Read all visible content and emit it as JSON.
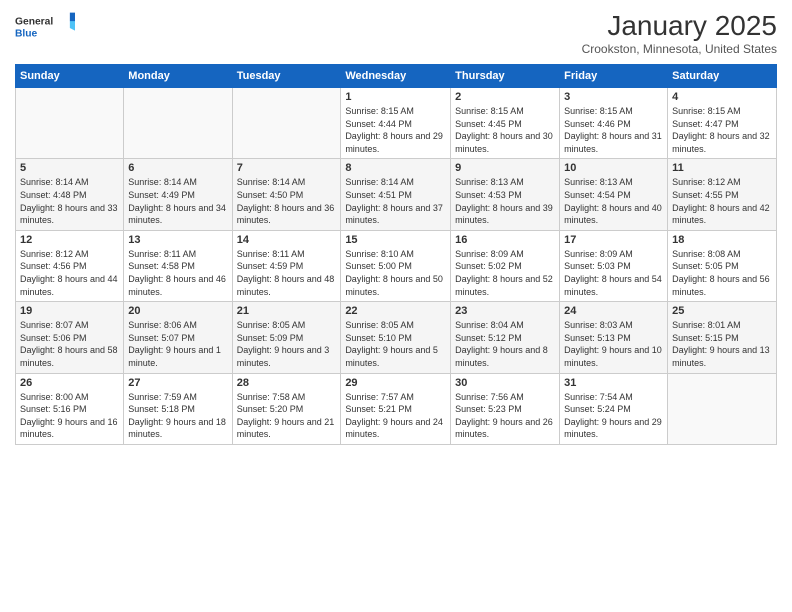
{
  "logo": {
    "general": "General",
    "blue": "Blue"
  },
  "header": {
    "title": "January 2025",
    "location": "Crookston, Minnesota, United States"
  },
  "weekdays": [
    "Sunday",
    "Monday",
    "Tuesday",
    "Wednesday",
    "Thursday",
    "Friday",
    "Saturday"
  ],
  "weeks": [
    [
      {
        "day": "",
        "sunrise": "",
        "sunset": "",
        "daylight": ""
      },
      {
        "day": "",
        "sunrise": "",
        "sunset": "",
        "daylight": ""
      },
      {
        "day": "",
        "sunrise": "",
        "sunset": "",
        "daylight": ""
      },
      {
        "day": "1",
        "sunrise": "Sunrise: 8:15 AM",
        "sunset": "Sunset: 4:44 PM",
        "daylight": "Daylight: 8 hours and 29 minutes."
      },
      {
        "day": "2",
        "sunrise": "Sunrise: 8:15 AM",
        "sunset": "Sunset: 4:45 PM",
        "daylight": "Daylight: 8 hours and 30 minutes."
      },
      {
        "day": "3",
        "sunrise": "Sunrise: 8:15 AM",
        "sunset": "Sunset: 4:46 PM",
        "daylight": "Daylight: 8 hours and 31 minutes."
      },
      {
        "day": "4",
        "sunrise": "Sunrise: 8:15 AM",
        "sunset": "Sunset: 4:47 PM",
        "daylight": "Daylight: 8 hours and 32 minutes."
      }
    ],
    [
      {
        "day": "5",
        "sunrise": "Sunrise: 8:14 AM",
        "sunset": "Sunset: 4:48 PM",
        "daylight": "Daylight: 8 hours and 33 minutes."
      },
      {
        "day": "6",
        "sunrise": "Sunrise: 8:14 AM",
        "sunset": "Sunset: 4:49 PM",
        "daylight": "Daylight: 8 hours and 34 minutes."
      },
      {
        "day": "7",
        "sunrise": "Sunrise: 8:14 AM",
        "sunset": "Sunset: 4:50 PM",
        "daylight": "Daylight: 8 hours and 36 minutes."
      },
      {
        "day": "8",
        "sunrise": "Sunrise: 8:14 AM",
        "sunset": "Sunset: 4:51 PM",
        "daylight": "Daylight: 8 hours and 37 minutes."
      },
      {
        "day": "9",
        "sunrise": "Sunrise: 8:13 AM",
        "sunset": "Sunset: 4:53 PM",
        "daylight": "Daylight: 8 hours and 39 minutes."
      },
      {
        "day": "10",
        "sunrise": "Sunrise: 8:13 AM",
        "sunset": "Sunset: 4:54 PM",
        "daylight": "Daylight: 8 hours and 40 minutes."
      },
      {
        "day": "11",
        "sunrise": "Sunrise: 8:12 AM",
        "sunset": "Sunset: 4:55 PM",
        "daylight": "Daylight: 8 hours and 42 minutes."
      }
    ],
    [
      {
        "day": "12",
        "sunrise": "Sunrise: 8:12 AM",
        "sunset": "Sunset: 4:56 PM",
        "daylight": "Daylight: 8 hours and 44 minutes."
      },
      {
        "day": "13",
        "sunrise": "Sunrise: 8:11 AM",
        "sunset": "Sunset: 4:58 PM",
        "daylight": "Daylight: 8 hours and 46 minutes."
      },
      {
        "day": "14",
        "sunrise": "Sunrise: 8:11 AM",
        "sunset": "Sunset: 4:59 PM",
        "daylight": "Daylight: 8 hours and 48 minutes."
      },
      {
        "day": "15",
        "sunrise": "Sunrise: 8:10 AM",
        "sunset": "Sunset: 5:00 PM",
        "daylight": "Daylight: 8 hours and 50 minutes."
      },
      {
        "day": "16",
        "sunrise": "Sunrise: 8:09 AM",
        "sunset": "Sunset: 5:02 PM",
        "daylight": "Daylight: 8 hours and 52 minutes."
      },
      {
        "day": "17",
        "sunrise": "Sunrise: 8:09 AM",
        "sunset": "Sunset: 5:03 PM",
        "daylight": "Daylight: 8 hours and 54 minutes."
      },
      {
        "day": "18",
        "sunrise": "Sunrise: 8:08 AM",
        "sunset": "Sunset: 5:05 PM",
        "daylight": "Daylight: 8 hours and 56 minutes."
      }
    ],
    [
      {
        "day": "19",
        "sunrise": "Sunrise: 8:07 AM",
        "sunset": "Sunset: 5:06 PM",
        "daylight": "Daylight: 8 hours and 58 minutes."
      },
      {
        "day": "20",
        "sunrise": "Sunrise: 8:06 AM",
        "sunset": "Sunset: 5:07 PM",
        "daylight": "Daylight: 9 hours and 1 minute."
      },
      {
        "day": "21",
        "sunrise": "Sunrise: 8:05 AM",
        "sunset": "Sunset: 5:09 PM",
        "daylight": "Daylight: 9 hours and 3 minutes."
      },
      {
        "day": "22",
        "sunrise": "Sunrise: 8:05 AM",
        "sunset": "Sunset: 5:10 PM",
        "daylight": "Daylight: 9 hours and 5 minutes."
      },
      {
        "day": "23",
        "sunrise": "Sunrise: 8:04 AM",
        "sunset": "Sunset: 5:12 PM",
        "daylight": "Daylight: 9 hours and 8 minutes."
      },
      {
        "day": "24",
        "sunrise": "Sunrise: 8:03 AM",
        "sunset": "Sunset: 5:13 PM",
        "daylight": "Daylight: 9 hours and 10 minutes."
      },
      {
        "day": "25",
        "sunrise": "Sunrise: 8:01 AM",
        "sunset": "Sunset: 5:15 PM",
        "daylight": "Daylight: 9 hours and 13 minutes."
      }
    ],
    [
      {
        "day": "26",
        "sunrise": "Sunrise: 8:00 AM",
        "sunset": "Sunset: 5:16 PM",
        "daylight": "Daylight: 9 hours and 16 minutes."
      },
      {
        "day": "27",
        "sunrise": "Sunrise: 7:59 AM",
        "sunset": "Sunset: 5:18 PM",
        "daylight": "Daylight: 9 hours and 18 minutes."
      },
      {
        "day": "28",
        "sunrise": "Sunrise: 7:58 AM",
        "sunset": "Sunset: 5:20 PM",
        "daylight": "Daylight: 9 hours and 21 minutes."
      },
      {
        "day": "29",
        "sunrise": "Sunrise: 7:57 AM",
        "sunset": "Sunset: 5:21 PM",
        "daylight": "Daylight: 9 hours and 24 minutes."
      },
      {
        "day": "30",
        "sunrise": "Sunrise: 7:56 AM",
        "sunset": "Sunset: 5:23 PM",
        "daylight": "Daylight: 9 hours and 26 minutes."
      },
      {
        "day": "31",
        "sunrise": "Sunrise: 7:54 AM",
        "sunset": "Sunset: 5:24 PM",
        "daylight": "Daylight: 9 hours and 29 minutes."
      },
      {
        "day": "",
        "sunrise": "",
        "sunset": "",
        "daylight": ""
      }
    ]
  ]
}
